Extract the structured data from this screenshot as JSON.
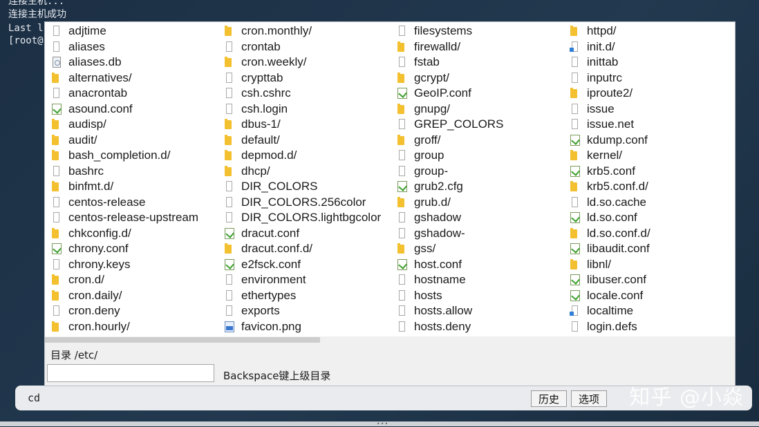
{
  "terminal": {
    "lines": [
      "连接主机...",
      "连接主机成功",
      "Last l",
      "[root@"
    ]
  },
  "watermark": "知乎 @小焱",
  "command_bar": {
    "command": "cd",
    "history_button": "历史",
    "options_button": "选项"
  },
  "dialog": {
    "dir_label": "目录 /etc/",
    "path_input_value": "",
    "hint": "Backspace键上级目录",
    "columns": [
      [
        {
          "name": "adjtime",
          "icon": "file"
        },
        {
          "name": "aliases",
          "icon": "file"
        },
        {
          "name": "aliases.db",
          "icon": "db"
        },
        {
          "name": "alternatives/",
          "icon": "folder"
        },
        {
          "name": "anacrontab",
          "icon": "file"
        },
        {
          "name": "asound.conf",
          "icon": "conf"
        },
        {
          "name": "audisp/",
          "icon": "folder"
        },
        {
          "name": "audit/",
          "icon": "folder"
        },
        {
          "name": "bash_completion.d/",
          "icon": "folder"
        },
        {
          "name": "bashrc",
          "icon": "file"
        },
        {
          "name": "binfmt.d/",
          "icon": "folder"
        },
        {
          "name": "centos-release",
          "icon": "file"
        },
        {
          "name": "centos-release-upstream",
          "icon": "file"
        },
        {
          "name": "chkconfig.d/",
          "icon": "folder"
        },
        {
          "name": "chrony.conf",
          "icon": "conf"
        },
        {
          "name": "chrony.keys",
          "icon": "file"
        },
        {
          "name": "cron.d/",
          "icon": "folder"
        },
        {
          "name": "cron.daily/",
          "icon": "folder"
        },
        {
          "name": "cron.deny",
          "icon": "file"
        },
        {
          "name": "cron.hourly/",
          "icon": "folder"
        }
      ],
      [
        {
          "name": "cron.monthly/",
          "icon": "folder"
        },
        {
          "name": "crontab",
          "icon": "file"
        },
        {
          "name": "cron.weekly/",
          "icon": "folder"
        },
        {
          "name": "crypttab",
          "icon": "file"
        },
        {
          "name": "csh.cshrc",
          "icon": "file"
        },
        {
          "name": "csh.login",
          "icon": "file"
        },
        {
          "name": "dbus-1/",
          "icon": "folder"
        },
        {
          "name": "default/",
          "icon": "folder"
        },
        {
          "name": "depmod.d/",
          "icon": "folder"
        },
        {
          "name": "dhcp/",
          "icon": "folder"
        },
        {
          "name": "DIR_COLORS",
          "icon": "file"
        },
        {
          "name": "DIR_COLORS.256color",
          "icon": "file"
        },
        {
          "name": "DIR_COLORS.lightbgcolor",
          "icon": "file"
        },
        {
          "name": "dracut.conf",
          "icon": "conf"
        },
        {
          "name": "dracut.conf.d/",
          "icon": "folder"
        },
        {
          "name": "e2fsck.conf",
          "icon": "conf"
        },
        {
          "name": "environment",
          "icon": "file"
        },
        {
          "name": "ethertypes",
          "icon": "file"
        },
        {
          "name": "exports",
          "icon": "file"
        },
        {
          "name": "favicon.png",
          "icon": "image"
        }
      ],
      [
        {
          "name": "filesystems",
          "icon": "file"
        },
        {
          "name": "firewalld/",
          "icon": "folder"
        },
        {
          "name": "fstab",
          "icon": "file"
        },
        {
          "name": "gcrypt/",
          "icon": "folder"
        },
        {
          "name": "GeoIP.conf",
          "icon": "conf"
        },
        {
          "name": "gnupg/",
          "icon": "folder"
        },
        {
          "name": "GREP_COLORS",
          "icon": "file"
        },
        {
          "name": "groff/",
          "icon": "folder"
        },
        {
          "name": "group",
          "icon": "file"
        },
        {
          "name": "group-",
          "icon": "file"
        },
        {
          "name": "grub2.cfg",
          "icon": "conf"
        },
        {
          "name": "grub.d/",
          "icon": "folder"
        },
        {
          "name": "gshadow",
          "icon": "file"
        },
        {
          "name": "gshadow-",
          "icon": "file"
        },
        {
          "name": "gss/",
          "icon": "folder"
        },
        {
          "name": "host.conf",
          "icon": "conf"
        },
        {
          "name": "hostname",
          "icon": "file"
        },
        {
          "name": "hosts",
          "icon": "file"
        },
        {
          "name": "hosts.allow",
          "icon": "file"
        },
        {
          "name": "hosts.deny",
          "icon": "file"
        }
      ],
      [
        {
          "name": "httpd/",
          "icon": "folder"
        },
        {
          "name": "init.d/",
          "icon": "link"
        },
        {
          "name": "inittab",
          "icon": "file"
        },
        {
          "name": "inputrc",
          "icon": "file"
        },
        {
          "name": "iproute2/",
          "icon": "folder"
        },
        {
          "name": "issue",
          "icon": "file"
        },
        {
          "name": "issue.net",
          "icon": "file"
        },
        {
          "name": "kdump.conf",
          "icon": "conf"
        },
        {
          "name": "kernel/",
          "icon": "folder"
        },
        {
          "name": "krb5.conf",
          "icon": "conf"
        },
        {
          "name": "krb5.conf.d/",
          "icon": "folder"
        },
        {
          "name": "ld.so.cache",
          "icon": "file"
        },
        {
          "name": "ld.so.conf",
          "icon": "conf"
        },
        {
          "name": "ld.so.conf.d/",
          "icon": "folder"
        },
        {
          "name": "libaudit.conf",
          "icon": "conf"
        },
        {
          "name": "libnl/",
          "icon": "folder"
        },
        {
          "name": "libuser.conf",
          "icon": "conf"
        },
        {
          "name": "locale.conf",
          "icon": "conf"
        },
        {
          "name": "localtime",
          "icon": "link"
        },
        {
          "name": "login.defs",
          "icon": "file"
        }
      ]
    ]
  }
}
